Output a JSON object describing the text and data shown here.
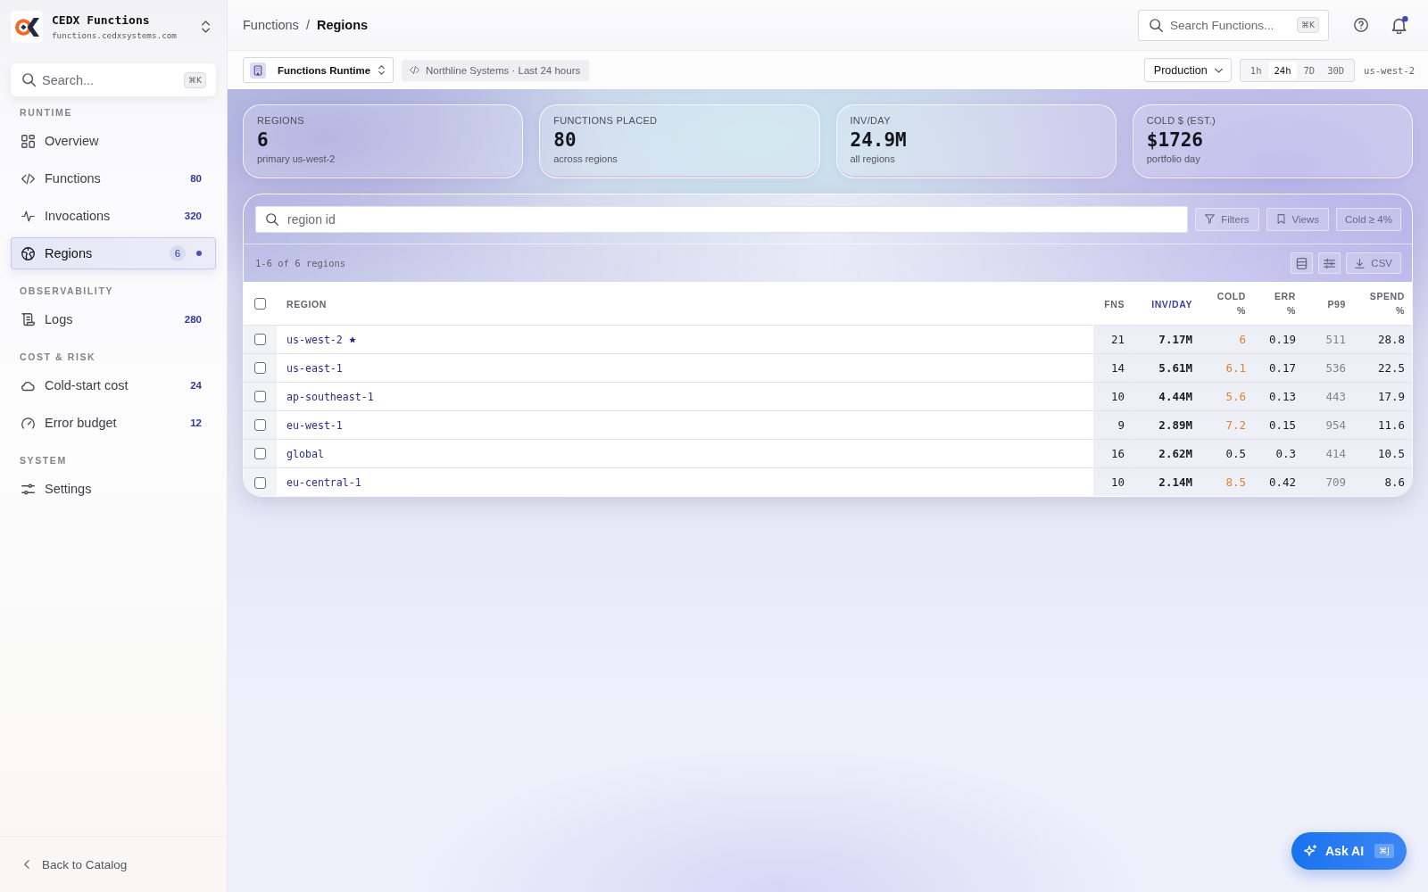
{
  "sidebar": {
    "brand": {
      "title": "CEDX Functions",
      "subtitle": "functions.cedxsystems.com"
    },
    "search": {
      "placeholder": "Search...",
      "shortcut": "⌘K"
    },
    "sections": [
      {
        "heading": "RUNTIME",
        "items": [
          {
            "label": "Overview",
            "selected": false
          },
          {
            "label": "Functions",
            "count": "80",
            "selected": false
          },
          {
            "label": "Invocations",
            "count": "320",
            "selected": false
          },
          {
            "label": "Regions",
            "count": "6",
            "selected": true
          }
        ]
      },
      {
        "heading": "OBSERVABILITY",
        "items": [
          {
            "label": "Logs",
            "count": "280",
            "selected": false
          }
        ]
      },
      {
        "heading": "COST & RISK",
        "items": [
          {
            "label": "Cold-start cost",
            "count": "24",
            "selected": false
          },
          {
            "label": "Error budget",
            "count": "12",
            "selected": false
          }
        ]
      },
      {
        "heading": "SYSTEM",
        "items": [
          {
            "label": "Settings",
            "selected": false
          }
        ]
      }
    ],
    "back_link": "Back to Catalog"
  },
  "topbar": {
    "breadcrumb": [
      "Functions",
      "Regions"
    ],
    "separator": "/",
    "search": {
      "placeholder": "Search Functions...",
      "shortcut": "⌘K"
    },
    "unread_notifications": true
  },
  "toolbar": {
    "runtime": "Functions Runtime",
    "context": "Northline Systems · Last 24 hours",
    "environment": "Production",
    "ranges": [
      {
        "label": "1h",
        "selected": false
      },
      {
        "label": "24h",
        "selected": true
      },
      {
        "label": "7D",
        "selected": false
      },
      {
        "label": "30D",
        "selected": false
      }
    ],
    "region": "us-west-2"
  },
  "stats": [
    {
      "label": "REGIONS",
      "value": "6",
      "caption": "primary us-west-2"
    },
    {
      "label": "FUNCTIONS PLACED",
      "value": "80",
      "caption": "across regions"
    },
    {
      "label": "INV/DAY",
      "value": "24.9M",
      "caption": "all regions"
    },
    {
      "label": "COLD $ (EST.)",
      "value": "$1726",
      "caption": "portfolio day"
    }
  ],
  "table": {
    "search": {
      "placeholder": "region id"
    },
    "buttons": [
      "Filters",
      "Views"
    ],
    "active_filter": "Cold ≥ 4%",
    "summary": "1-6 of 6 regions",
    "export": "CSV",
    "select_all_checked": false,
    "columns": [
      {
        "label": "REGION",
        "sorted": false
      },
      {
        "label": "FNS",
        "sorted": false
      },
      {
        "label": "INV/DAY",
        "sorted": true
      },
      {
        "label": "COLD %",
        "sorted": false
      },
      {
        "label": "ERR %",
        "sorted": false
      },
      {
        "label": "P99",
        "sorted": false
      },
      {
        "label": "SPEND %",
        "sorted": false
      }
    ],
    "rows": [
      {
        "region": "us-west-2",
        "primary": true,
        "checked": false,
        "fns": "21",
        "inv_day": "7.17M",
        "cold": "6",
        "cold_warn": true,
        "err": "0.19",
        "p99": "511",
        "spend": "28.8"
      },
      {
        "region": "us-east-1",
        "primary": false,
        "checked": false,
        "fns": "14",
        "inv_day": "5.61M",
        "cold": "6.1",
        "cold_warn": true,
        "err": "0.17",
        "p99": "536",
        "spend": "22.5"
      },
      {
        "region": "ap-southeast-1",
        "primary": false,
        "checked": false,
        "fns": "10",
        "inv_day": "4.44M",
        "cold": "5.6",
        "cold_warn": true,
        "err": "0.13",
        "p99": "443",
        "spend": "17.9"
      },
      {
        "region": "eu-west-1",
        "primary": false,
        "checked": false,
        "fns": "9",
        "inv_day": "2.89M",
        "cold": "7.2",
        "cold_warn": true,
        "err": "0.15",
        "p99": "954",
        "spend": "11.6"
      },
      {
        "region": "global",
        "primary": false,
        "checked": false,
        "fns": "16",
        "inv_day": "2.62M",
        "cold": "0.5",
        "cold_warn": false,
        "err": "0.3",
        "p99": "414",
        "spend": "10.5"
      },
      {
        "region": "eu-central-1",
        "primary": false,
        "checked": false,
        "fns": "10",
        "inv_day": "2.14M",
        "cold": "8.5",
        "cold_warn": true,
        "err": "0.42",
        "p99": "709",
        "spend": "8.6"
      }
    ]
  },
  "assistant": {
    "label": "Ask AI",
    "shortcut": "⌘J"
  }
}
